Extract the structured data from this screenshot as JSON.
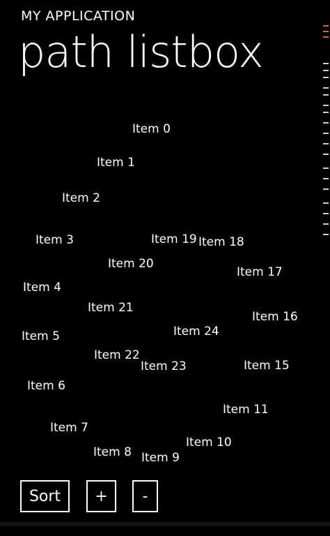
{
  "header": {
    "app_title": "MY APPLICATION",
    "page_title": "path listbox"
  },
  "items": [
    {
      "label": "Item 0"
    },
    {
      "label": "Item 1"
    },
    {
      "label": "Item 2"
    },
    {
      "label": "Item 3"
    },
    {
      "label": "Item 4"
    },
    {
      "label": "Item 5"
    },
    {
      "label": "Item 6"
    },
    {
      "label": "Item 7"
    },
    {
      "label": "Item 8"
    },
    {
      "label": "Item 9"
    },
    {
      "label": "Item 10"
    },
    {
      "label": "Item 11"
    },
    {
      "label": "Item 15"
    },
    {
      "label": "Item 16"
    },
    {
      "label": "Item 17"
    },
    {
      "label": "Item 18"
    },
    {
      "label": "Item 19"
    },
    {
      "label": "Item 20"
    },
    {
      "label": "Item 21"
    },
    {
      "label": "Item 22"
    },
    {
      "label": "Item 23"
    },
    {
      "label": "Item 24"
    }
  ],
  "buttons": {
    "sort": "Sort",
    "add": "+",
    "remove": "-"
  },
  "colors": {
    "background": "#000000",
    "foreground": "#ffffff",
    "accent": "#e06a2a"
  }
}
